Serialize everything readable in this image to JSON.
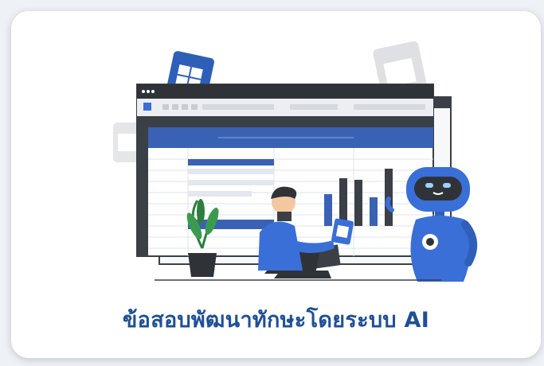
{
  "card": {
    "title": "ข้อสอบพัฒนาทักษะโดยระบบ AI",
    "illustration": "spreadsheet-ai-robot-illustration",
    "accent_color": "#3a6fd8",
    "title_color": "#1f4f96"
  }
}
